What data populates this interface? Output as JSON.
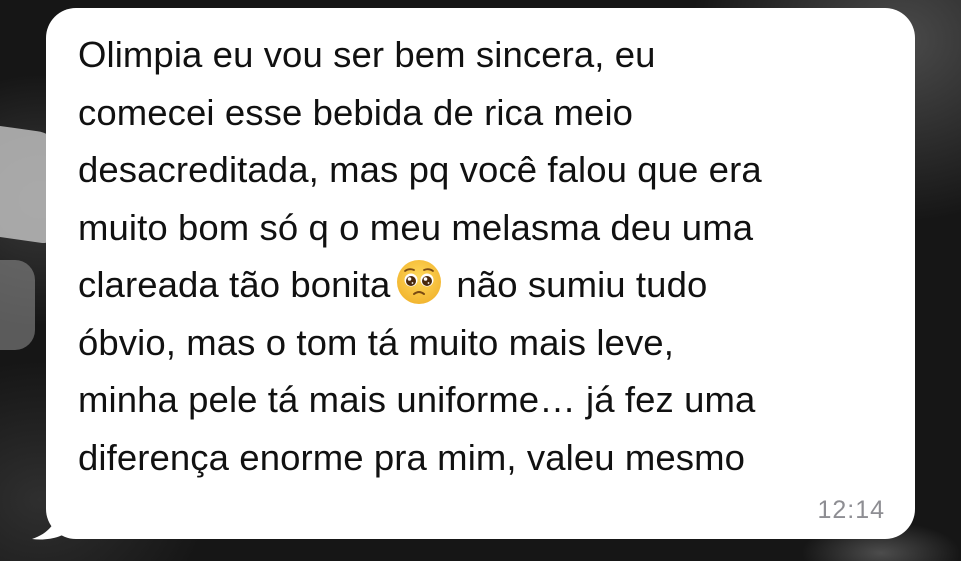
{
  "message": {
    "line_1": "Olimpia eu vou ser bem sincera, eu",
    "line_2": "comecei esse bebida de rica meio",
    "line_3": "desacreditada, mas pq você falou que era",
    "line_4": "muito bom só q o meu melasma deu uma",
    "line_5_before_emoji": "clareada tão bonita",
    "line_5_after_emoji": "não sumiu tudo",
    "line_6": "óbvio, mas o tom tá muito mais leve,",
    "line_7": "minha pele tá mais uniforme… já fez uma",
    "line_8": "diferença enorme pra mim, valeu mesmo",
    "emoji": "pleading-face-icon",
    "timestamp": "12:14"
  },
  "colors": {
    "bubble": "#ffffff",
    "text": "#111111",
    "timestamp": "#8e8e93",
    "background": "#161616",
    "emoji_face": "#f7c23b"
  }
}
